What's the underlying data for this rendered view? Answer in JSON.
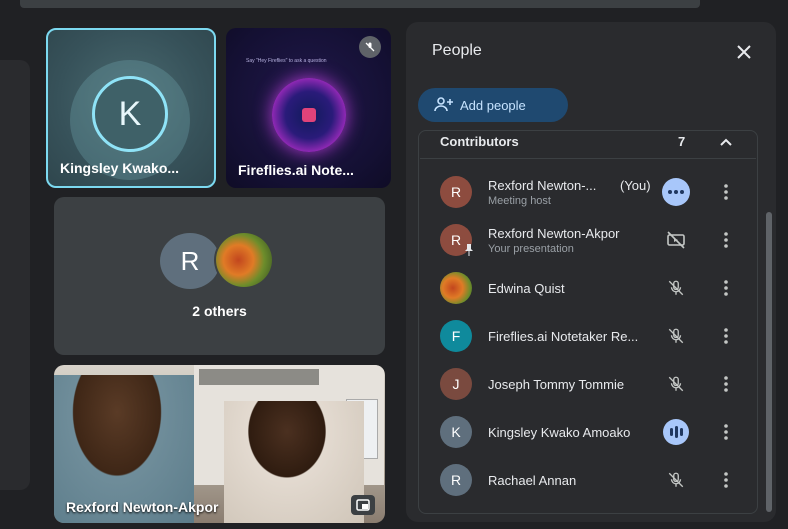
{
  "tiles": {
    "kingsley": {
      "initial": "K",
      "name": "Kingsley Kwako..."
    },
    "fireflies": {
      "name": "Fireflies.ai Note...",
      "prompt": "Say \"Hey Fireflies\" to ask a question"
    },
    "others": {
      "initial": "R",
      "label": "2 others"
    },
    "video": {
      "name": "Rexford Newton-Akpor"
    }
  },
  "panel": {
    "title": "People",
    "add_people_label": "Add people",
    "section_label": "Contributors",
    "section_count": "7",
    "participants": [
      {
        "initial": "R",
        "name": "Rexford Newton-...",
        "you": "(You)",
        "subtitle": "Meeting host",
        "color": "#8d4c3f",
        "indicator": "more-options-blue"
      },
      {
        "initial": "R",
        "name": "Rexford Newton-Akpor",
        "subtitle": "Your presentation",
        "color": "#8d4c3f",
        "indicator": "presentation-off-icon"
      },
      {
        "initial": "",
        "name": "Edwina Quist",
        "subtitle": "",
        "color": "#c2461e",
        "indicator": "mic-off-icon"
      },
      {
        "initial": "F",
        "name": "Fireflies.ai Notetaker Re...",
        "subtitle": "",
        "color": "#0f8a9c",
        "indicator": "mic-off-icon"
      },
      {
        "initial": "J",
        "name": "Joseph Tommy Tommie",
        "subtitle": "",
        "color": "#7a4a3f",
        "indicator": "mic-off-icon"
      },
      {
        "initial": "K",
        "name": "Kingsley Kwako Amoako",
        "subtitle": "",
        "color": "#5f6f7d",
        "indicator": "speaking-icon"
      },
      {
        "initial": "R",
        "name": "Rachael Annan",
        "subtitle": "",
        "color": "#5f6f7d",
        "indicator": "mic-off-icon"
      }
    ]
  },
  "colors": {
    "accent": "#a8c7fa",
    "panel_bg": "#2a2b2e",
    "page_bg": "#202124",
    "focus_ring": "#7cd9f0"
  }
}
